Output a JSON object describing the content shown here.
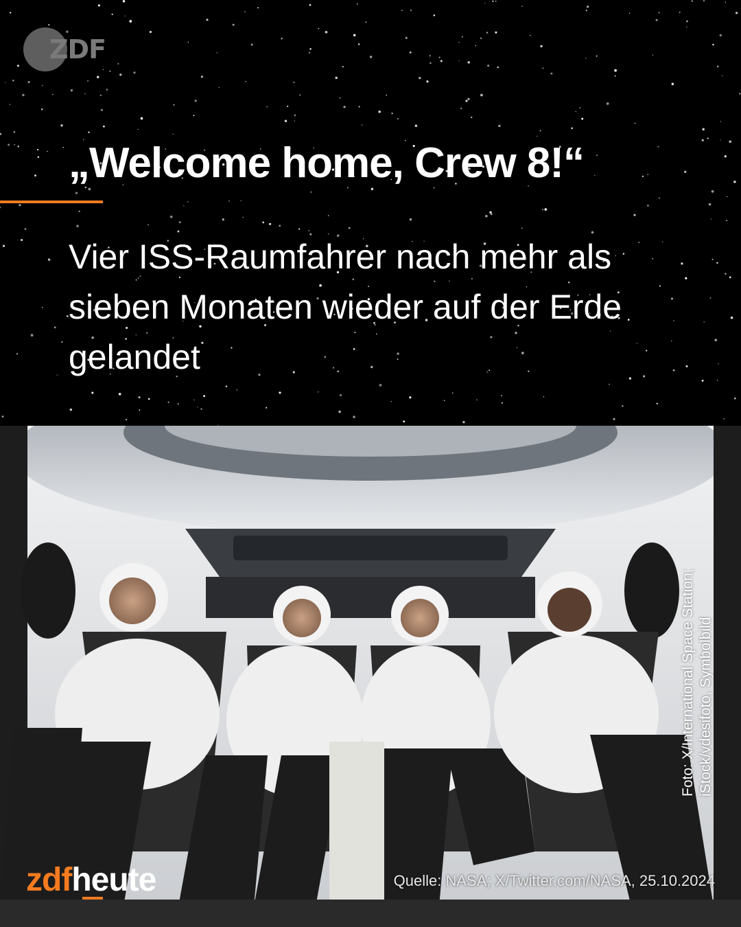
{
  "logo": {
    "text": "ZDF"
  },
  "headline": "„Welcome home, Crew 8!“",
  "subline": "Vier ISS-Raumfahrer nach mehr als sieben Monaten wieder auf der Erde gelandet",
  "photo_credit": "Foto: X/International Space Station; iStock/vdesifoto, Symbolbild",
  "brand": {
    "part1": "zdf",
    "part2": "heute"
  },
  "source": "Quelle: NASA; X/Twitter.com/NASA, 25.10.2024",
  "colors": {
    "accent": "#f47b20",
    "background": "#000000",
    "text": "#ffffff"
  }
}
